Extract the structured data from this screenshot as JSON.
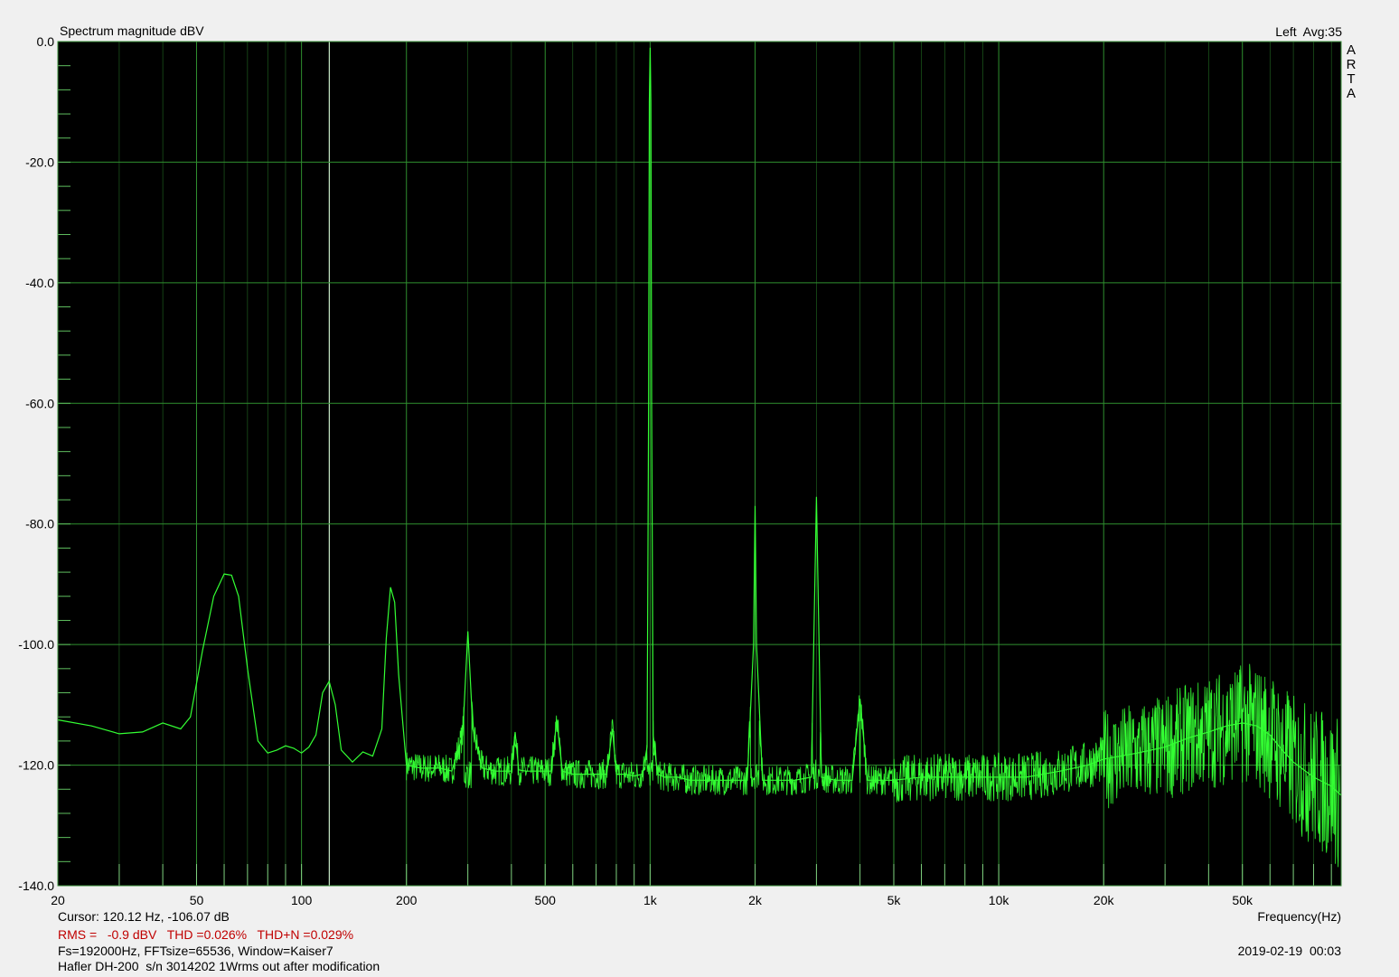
{
  "header": {
    "title": "Spectrum magnitude dBV",
    "channel_avg": "Left  Avg:35"
  },
  "brand": [
    "A",
    "R",
    "T",
    "A"
  ],
  "footer": {
    "cursor": "Cursor: 120.12 Hz, -106.07 dB",
    "rms_line": "RMS =   -0.9 dBV   THD =0.026%   THD+N =0.029%",
    "fs_line": "Fs=192000Hz, FFTsize=65536, Window=Kaiser7",
    "description": "Hafler DH-200  s/n 3014202 1Wrms out after modification",
    "timestamp": "2019-02-19  00:03",
    "xlabel": "Frequency(Hz)"
  },
  "colors": {
    "plot_bg": "#000000",
    "grid": "#2f8f2f",
    "trace": "#33ff33",
    "page_bg": "#f0f0f0",
    "status_red": "#c00000"
  },
  "chart_data": {
    "type": "line",
    "title": "Spectrum magnitude dBV",
    "xlabel": "Frequency(Hz)",
    "ylabel": "",
    "xscale": "log",
    "xlim": [
      20,
      96000
    ],
    "ylim": [
      -140,
      0
    ],
    "grid": true,
    "x_ticks": [
      20,
      50,
      100,
      200,
      500,
      1000,
      2000,
      5000,
      10000,
      20000,
      50000
    ],
    "x_tick_labels": [
      "20",
      "50",
      "100",
      "200",
      "500",
      "1k",
      "2k",
      "5k",
      "10k",
      "20k",
      "50k"
    ],
    "y_ticks": [
      0,
      -20,
      -40,
      -60,
      -80,
      -100,
      -120,
      -140
    ],
    "y_tick_labels": [
      "0.0",
      "-20.0",
      "-40.0",
      "-60.0",
      "-80.0",
      "-100.0",
      "-120.0",
      "-140.0"
    ],
    "series": [
      {
        "x": [
          20,
          25,
          30,
          35,
          40,
          45,
          48,
          52,
          56,
          60,
          63,
          66,
          70,
          75,
          80,
          85,
          90,
          95,
          100,
          105,
          110,
          115,
          120,
          125,
          130,
          140,
          150,
          160,
          170,
          175,
          180,
          185,
          190,
          200,
          220,
          250,
          270,
          290,
          300,
          310,
          330,
          360,
          400,
          410,
          420,
          440,
          480,
          520,
          540,
          560,
          600,
          650,
          700,
          750,
          780,
          800,
          850,
          900,
          950,
          980,
          990,
          995,
          1000,
          1005,
          1010,
          1020,
          1050,
          1100,
          1200,
          1300,
          1500,
          1700,
          1900,
          1980,
          2000,
          2020,
          2100,
          2300,
          2600,
          2900,
          3000,
          3100,
          3400,
          3800,
          4000,
          4200,
          5000,
          6000,
          7000,
          8000,
          10000,
          12000,
          15000,
          18000,
          20000,
          25000,
          30000,
          35000,
          40000,
          45000,
          50000,
          55000,
          60000,
          65000,
          70000,
          80000,
          90000,
          96000
        ],
        "y": [
          -112.5,
          -113.5,
          -114.8,
          -114.5,
          -113,
          -114,
          -112,
          -101,
          -92,
          -88.3,
          -88.5,
          -92,
          -104,
          -116,
          -118,
          -117.5,
          -116.8,
          -117.2,
          -118,
          -117,
          -115,
          -108,
          -106.1,
          -110,
          -117.5,
          -119.5,
          -117.8,
          -118.5,
          -114,
          -99,
          -90.5,
          -93,
          -105,
          -120,
          -120.5,
          -120.5,
          -121,
          -115,
          -97.8,
          -114,
          -120.5,
          -121,
          -121,
          -114.5,
          -120.8,
          -121,
          -121,
          -121,
          -112.5,
          -121,
          -121.5,
          -121.5,
          -121.5,
          -121.5,
          -114,
          -121.5,
          -121.5,
          -121.8,
          -121.5,
          -117,
          -60,
          -10,
          -1,
          -10,
          -60,
          -115,
          -121.5,
          -122,
          -122,
          -122.5,
          -122.5,
          -122.5,
          -122.5,
          -100,
          -77,
          -100,
          -122.5,
          -122.5,
          -122.5,
          -122,
          -75.5,
          -122,
          -122.5,
          -122.5,
          -109,
          -122.5,
          -122.5,
          -122,
          -122,
          -122,
          -122,
          -122,
          -121,
          -120,
          -119,
          -118,
          -117,
          -115.5,
          -114.5,
          -113.5,
          -113,
          -113.5,
          -115,
          -117.5,
          -119.5,
          -122,
          -123.5,
          -125
        ]
      }
    ]
  }
}
